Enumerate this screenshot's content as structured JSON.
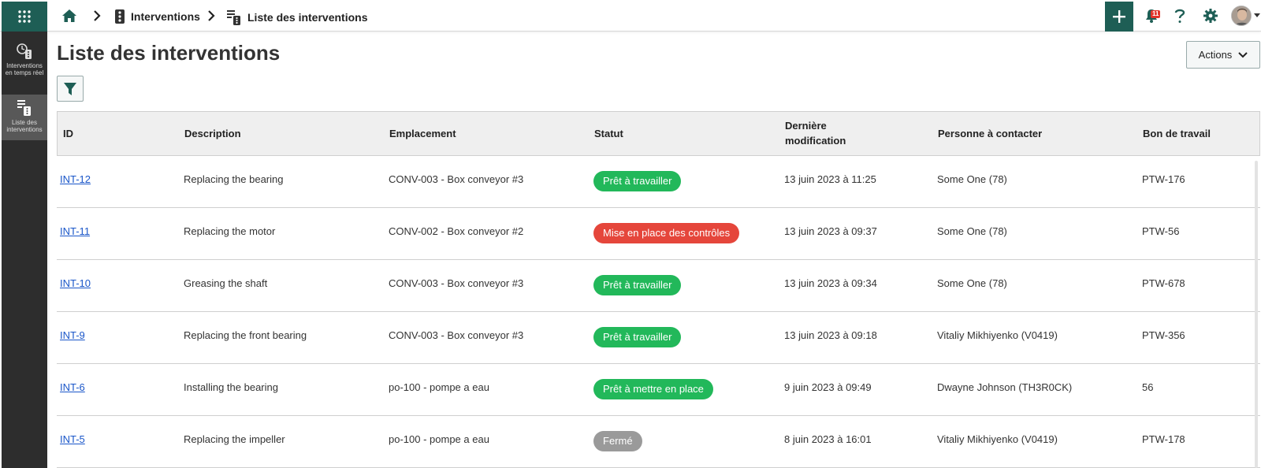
{
  "topbar": {
    "breadcrumbs": [
      "Interventions",
      "Liste des interventions"
    ],
    "notification_count": "11"
  },
  "sidebar": {
    "items": [
      {
        "label": "Interventions en temps réel",
        "active": false
      },
      {
        "label": "Liste des interventions",
        "active": true
      }
    ]
  },
  "page": {
    "title": "Liste des interventions",
    "actions_label": "Actions"
  },
  "table": {
    "columns": [
      "ID",
      "Description",
      "Emplacement",
      "Statut",
      "Dernière modification",
      "Personne à contacter",
      "Bon de travail"
    ],
    "rows": [
      {
        "id": "INT-12",
        "description": "Replacing the bearing",
        "location": "CONV-003 - Box conveyor #3",
        "status": "Prêt à travailler",
        "status_color": "#22b85a",
        "modified": "13 juin 2023 à 11:25",
        "contact": "Some One (78)",
        "work_order": "PTW-176"
      },
      {
        "id": "INT-11",
        "description": "Replacing the motor",
        "location": "CONV-002 - Box conveyor #2",
        "status": "Mise en place des contrôles",
        "status_color": "#e5463b",
        "modified": "13 juin 2023 à 09:37",
        "contact": "Some One (78)",
        "work_order": "PTW-56"
      },
      {
        "id": "INT-10",
        "description": "Greasing the shaft",
        "location": "CONV-003 - Box conveyor #3",
        "status": "Prêt à travailler",
        "status_color": "#22b85a",
        "modified": "13 juin 2023 à 09:34",
        "contact": "Some One (78)",
        "work_order": "PTW-678"
      },
      {
        "id": "INT-9",
        "description": "Replacing the front bearing",
        "location": "CONV-003 - Box conveyor #3",
        "status": "Prêt à travailler",
        "status_color": "#22b85a",
        "modified": "13 juin 2023 à 09:18",
        "contact": "Vitaliy Mikhiyenko (V0419)",
        "work_order": "PTW-356"
      },
      {
        "id": "INT-6",
        "description": "Installing the bearing",
        "location": "po-100 - pompe a eau",
        "status": "Prêt à mettre en place",
        "status_color": "#22b85a",
        "modified": "9 juin 2023 à 09:49",
        "contact": "Dwayne Johnson (TH3R0CK)",
        "work_order": "56"
      },
      {
        "id": "INT-5",
        "description": "Replacing the impeller",
        "location": "po-100 - pompe a eau",
        "status": "Fermé",
        "status_color": "#9a9a9a",
        "modified": "8 juin 2023 à 16:01",
        "contact": "Vitaliy Mikhiyenko (V0419)",
        "work_order": "PTW-178"
      }
    ]
  },
  "colors": {
    "brand": "#1e5e55",
    "sidebar": "#2d2d2d",
    "link": "#1a56c9",
    "notification": "#e0352b"
  }
}
